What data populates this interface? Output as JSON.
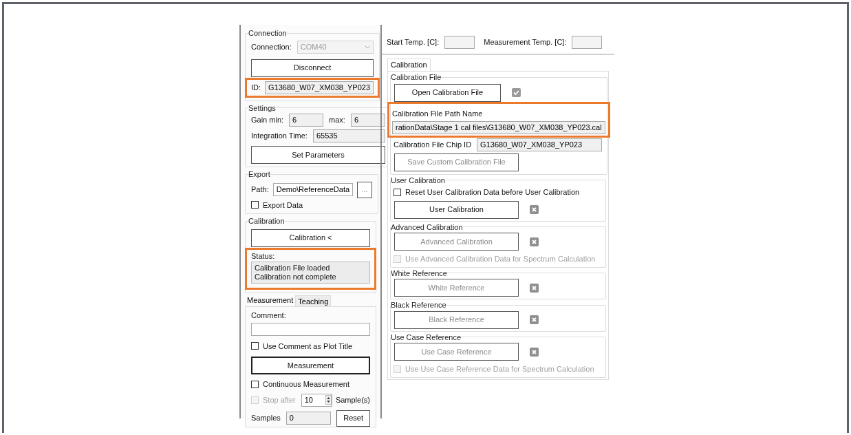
{
  "connection": {
    "title": "Connection",
    "label": "Connection:",
    "port": "COM40",
    "button": "Disconnect",
    "id_label": "ID:",
    "id_value": "G13680_W07_XM038_YP023",
    "highlighted": true
  },
  "settings": {
    "title": "Settings",
    "gain_min_label": "Gain min:",
    "gain_min": "6",
    "gain_max_label": "max:",
    "gain_max": "6",
    "integration_label": "Integration Time:",
    "integration": "65535",
    "button": "Set Parameters"
  },
  "export": {
    "title": "Export",
    "path_label": "Path:",
    "path": "Demo\\ReferenceData",
    "browse": "...",
    "checkbox": {
      "label": "Export Data",
      "checked": false
    }
  },
  "calibration": {
    "title": "Calibration",
    "button": "Calibration <",
    "status_label": "Status:",
    "status_lines": [
      "Calibration File loaded",
      "Calibration not complete"
    ],
    "highlighted": true
  },
  "left_tabs": [
    {
      "label": "Measurement",
      "selected": true
    },
    {
      "label": "Teaching",
      "selected": false
    }
  ],
  "measurement": {
    "comment_label": "Comment:",
    "use_comment": {
      "label": "Use Comment as Plot Title",
      "checked": false
    },
    "button": "Measurement",
    "continuous": {
      "label": "Continuous Measurement",
      "checked": false
    },
    "stop_after": {
      "label": "Stop after",
      "checked": false,
      "disabled": true
    },
    "stop_value": "10",
    "stop_unit": "Sample(s)",
    "samples_label": "Samples",
    "samples": "0",
    "reset": "Reset"
  },
  "temps": [
    {
      "label": "Start Temp. [C]:"
    },
    {
      "label": "Measurement Temp. [C]:"
    }
  ],
  "right_tabs": [
    {
      "label": "Calibration",
      "selected": true
    }
  ],
  "calibration_file": {
    "title": "Calibration File",
    "button": "Open Calibration File",
    "loaded": true,
    "path_label": "Calibration File Path Name",
    "path": "rationData\\Stage 1 cal files\\G13680_W07_XM038_YP023.cal",
    "highlighted": true,
    "chip_label": "Calibration File Chip ID",
    "chip_id": "G13680_W07_XM038_YP023",
    "save_button": "Save Custom Calibration File",
    "save_disabled": true
  },
  "sections": [
    {
      "title": "User Calibration",
      "pre_checkbox": {
        "label": "Reset User Calibration Data before User Calibration",
        "checked": false,
        "disabled": false
      },
      "button": "User Calibration",
      "disabled": false,
      "done": false
    },
    {
      "title": "Advanced Calibration",
      "button": "Advanced Calibration",
      "disabled": true,
      "done": false,
      "post_checkbox": {
        "label": "Use Advanced Calibration Data for Spectrum Calculation",
        "checked": false,
        "disabled": true
      }
    },
    {
      "title": "White Reference",
      "button": "White Reference",
      "disabled": true,
      "done": false
    },
    {
      "title": "Black Reference",
      "button": "Black Reference",
      "disabled": true,
      "done": false
    },
    {
      "title": "Use Case Reference",
      "button": "Use Case Reference",
      "disabled": true,
      "done": false,
      "post_checkbox": {
        "label": "Use Use Case Reference Data for Spectrum Calculation",
        "checked": false,
        "disabled": true
      }
    }
  ]
}
